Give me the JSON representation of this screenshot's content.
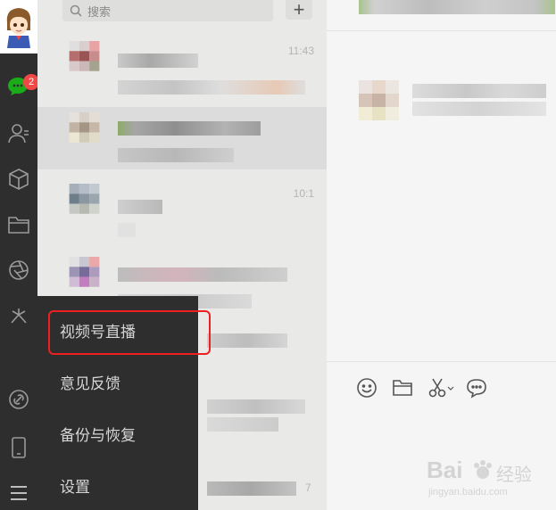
{
  "sidebar": {
    "chat_badge": "2",
    "icons": [
      "avatar",
      "chat-icon",
      "contacts-icon",
      "cube-icon",
      "folder-icon",
      "aperture-icon",
      "sparkle-icon",
      "link-icon",
      "phone-icon",
      "menu-icon"
    ]
  },
  "search": {
    "placeholder": "搜索",
    "add_label": "+"
  },
  "chat_list": {
    "rows": [
      {
        "time": "11:43"
      },
      {
        "time": ""
      },
      {
        "time": "10:1"
      },
      {
        "time": ""
      }
    ],
    "tail_fragment": "7"
  },
  "popup_menu": {
    "items": [
      {
        "label": "视频号直播"
      },
      {
        "label": "意见反馈"
      },
      {
        "label": "备份与恢复"
      },
      {
        "label": "设置"
      }
    ]
  },
  "conversation": {
    "toolbar_icons": [
      "emoji-icon",
      "folder-icon",
      "scissors-icon",
      "chat-bubble-icon"
    ]
  },
  "watermark": {
    "brand": "Bai",
    "brand_suffix": "经验",
    "url": "jingyan.baidu.com"
  },
  "colors": {
    "rail": "#2e2e2e",
    "list_bg": "#e9e9e8",
    "badge": "#f04747",
    "highlight": "#f01f1f",
    "menu_text": "#d6d6d6"
  }
}
